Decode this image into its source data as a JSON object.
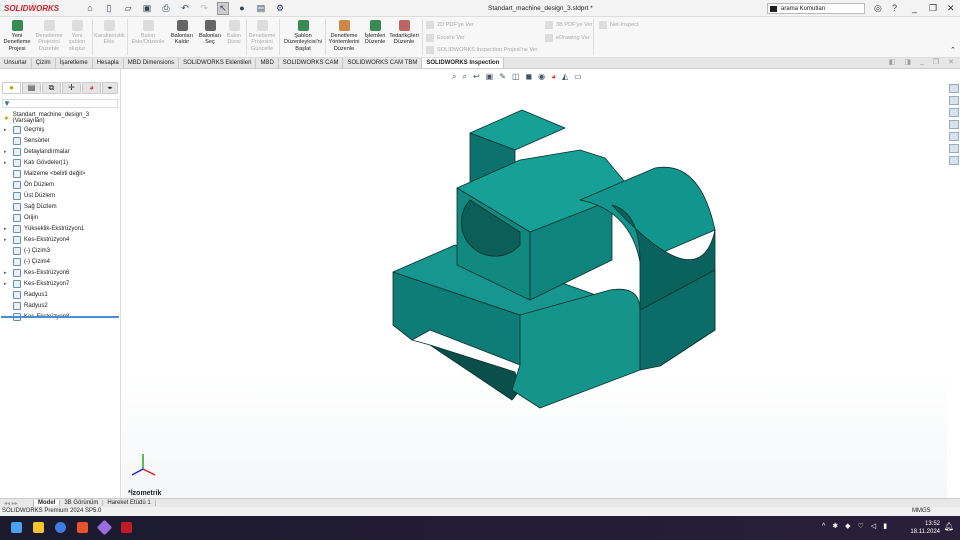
{
  "app": {
    "logo": "SOLIDWORKS",
    "doc_title": "Standart_machine_design_3.sldprt *",
    "search_placeholder": "arama Komutları"
  },
  "ribbon": {
    "buttons": [
      {
        "label": "Yeni Denetleme Projesi",
        "enabled": true
      },
      {
        "label": "Denetleme Projesini Düzenle",
        "enabled": false
      },
      {
        "label": "Yeni şablon oluştur",
        "enabled": false
      },
      {
        "label": "Karakteristik Ekle",
        "enabled": false
      },
      {
        "label": "Balon Ekle/Düzenle",
        "enabled": false
      },
      {
        "label": "Balonları Kaldır",
        "enabled": true
      },
      {
        "label": "Balonları Seç",
        "enabled": true
      },
      {
        "label": "Balon Dizisi",
        "enabled": false
      },
      {
        "label": "Denetleme Projesini Güncelle",
        "enabled": false
      },
      {
        "label": "Şablon Düzenleyicisi'ni Başlat",
        "enabled": true
      },
      {
        "label": "Denetleme Yöntemlerini Düzenle",
        "enabled": true
      },
      {
        "label": "İşlemleri Düzenle",
        "enabled": true
      },
      {
        "label": "Tedarikçileri Düzenle",
        "enabled": true
      }
    ],
    "small": [
      "2D PDF'ye Ver",
      "Excel'e Ver",
      "SOLIDWORKS Inspection Projesi'ne Ver",
      "3B PDF'ye Ver",
      "eDrawing Ver",
      "Net-Inspect"
    ]
  },
  "tabs": [
    "Unsurlar",
    "Çizim",
    "İşaretleme",
    "Hesapla",
    "MBD Dimensions",
    "SOLIDWORKS Eklentileri",
    "MBD",
    "SOLIDWORKS CAM",
    "SOLIDWORKS CAM TBM",
    "SOLIDWORKS Inspection"
  ],
  "active_tab": "SOLIDWORKS Inspection",
  "tree": {
    "root": "Standart_machine_design_3 (Varsayılan)",
    "items": [
      {
        "label": "Geçmiş",
        "expand": true
      },
      {
        "label": "Sensörler",
        "expand": false
      },
      {
        "label": "Detaylandırmalar",
        "expand": true
      },
      {
        "label": "Katı Gövdeler(1)",
        "expand": true
      },
      {
        "label": "Malzeme <belirli değil>",
        "expand": false
      },
      {
        "label": "Ön Düzlem",
        "expand": false
      },
      {
        "label": "Üst Düzlem",
        "expand": false
      },
      {
        "label": "Sağ Düzlem",
        "expand": false
      },
      {
        "label": "Orijin",
        "expand": false
      },
      {
        "label": "Yükseklik-Ekstrüzyon1",
        "expand": true
      },
      {
        "label": "Kes-Ekstrüzyon4",
        "expand": true
      },
      {
        "label": "(-) Çizim3",
        "expand": false
      },
      {
        "label": "(-) Çizim4",
        "expand": false
      },
      {
        "label": "Kes-Ekstrüzyon6",
        "expand": true
      },
      {
        "label": "Kes-Ekstrüzyon7",
        "expand": true
      },
      {
        "label": "Radyus1",
        "expand": false
      },
      {
        "label": "Radyus2",
        "expand": false
      },
      {
        "label": "Kes-Ekstrüzyon8",
        "expand": true
      }
    ]
  },
  "viewport": {
    "view_label": "*İzometrik",
    "model_color": "#13918a"
  },
  "bottom_tabs": [
    "Model",
    "3B Görünüm",
    "Hareket Etüdü 1"
  ],
  "status": {
    "text": "SOLIDWORKS Premium 2024 SP5.0",
    "units": "MMGS"
  },
  "taskbar": {
    "time": "13:52",
    "date": "18.11.2024"
  }
}
